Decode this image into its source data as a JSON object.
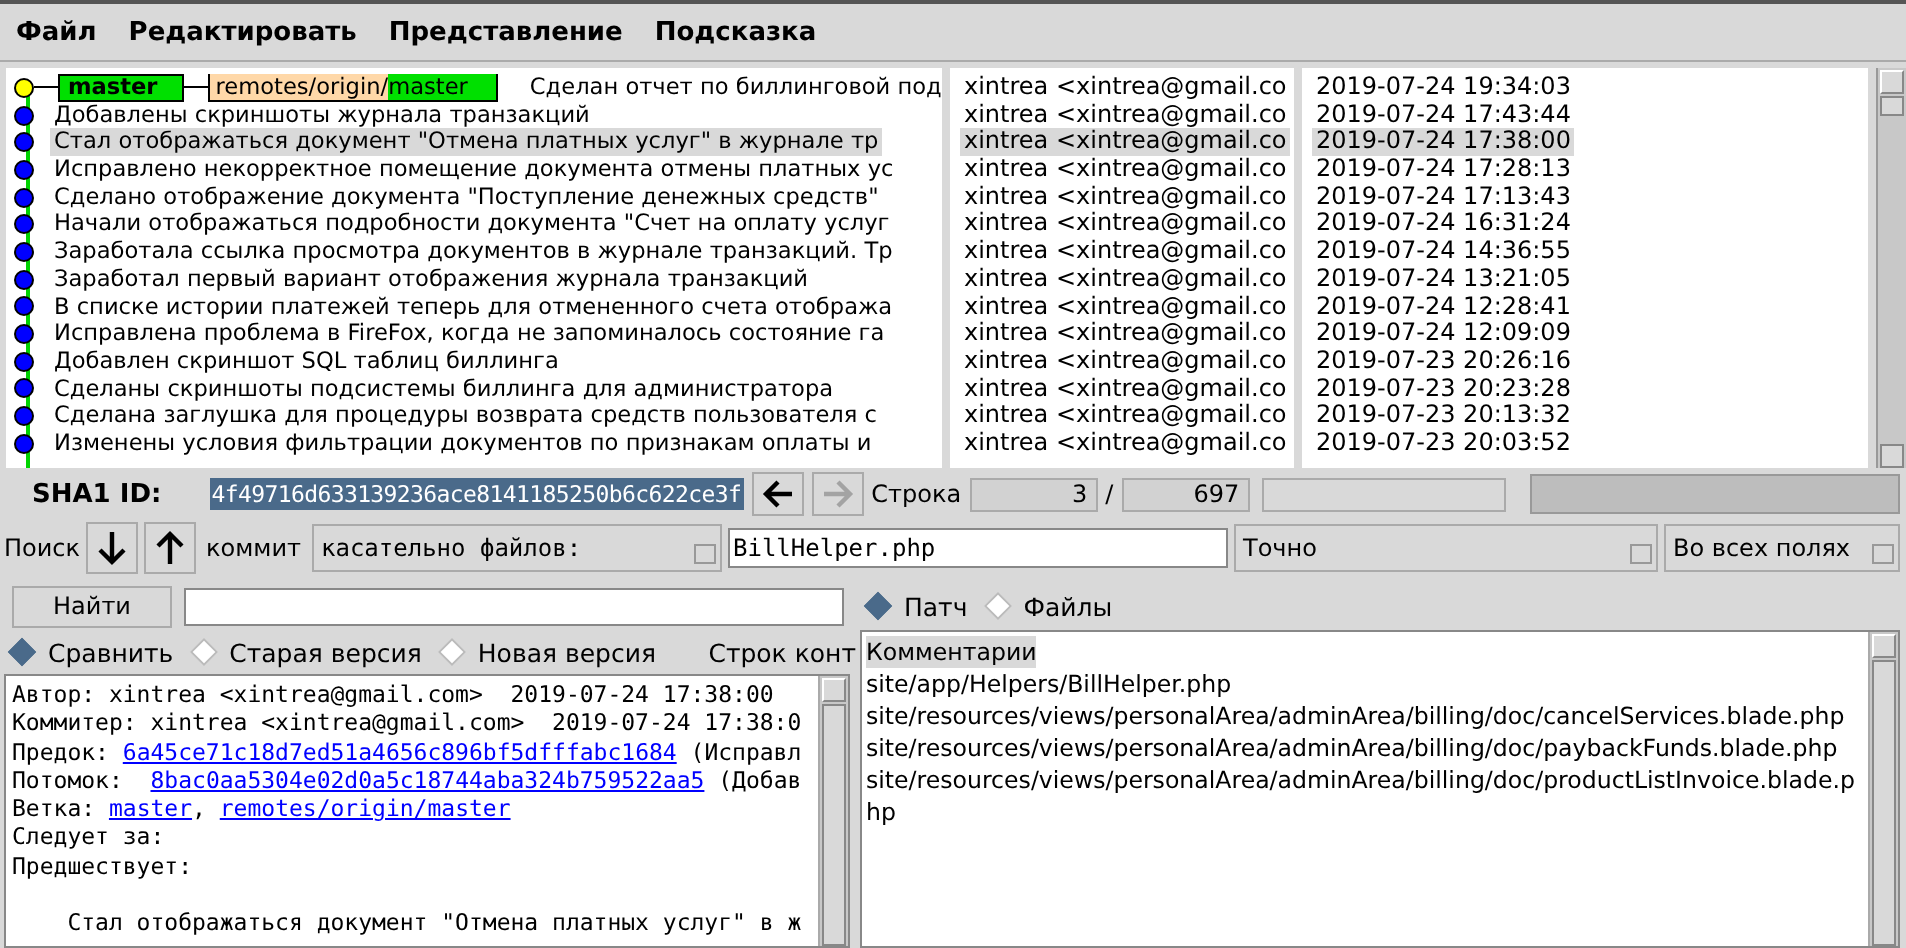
{
  "menu": [
    "Файл",
    "Редактировать",
    "Представление",
    "Подсказка"
  ],
  "refs": [
    {
      "kind": "local",
      "name": "master"
    },
    {
      "kind": "remote",
      "prefix": "remotes/origin/",
      "name": "master"
    }
  ],
  "commits": [
    {
      "message": "Сделан отчет по биллинговой под",
      "author": "xintrea <xintrea@gmail.co",
      "date": "2019-07-24 19:34:03",
      "head": true,
      "selected": false
    },
    {
      "message": "Добавлены скриншоты журнала транзакций",
      "author": "xintrea <xintrea@gmail.co",
      "date": "2019-07-24 17:43:44",
      "head": false,
      "selected": false
    },
    {
      "message": "Стал отображаться документ \"Отмена платных услуг\" в журнале тр",
      "author": "xintrea <xintrea@gmail.co",
      "date": "2019-07-24 17:38:00",
      "head": false,
      "selected": true
    },
    {
      "message": "Исправлено некорректное помещение документа отмены платных ус",
      "author": "xintrea <xintrea@gmail.co",
      "date": "2019-07-24 17:28:13",
      "head": false,
      "selected": false
    },
    {
      "message": "Сделано отображение документа \"Поступление денежных средств\"",
      "author": "xintrea <xintrea@gmail.co",
      "date": "2019-07-24 17:13:43",
      "head": false,
      "selected": false
    },
    {
      "message": "Начали отображаться подробности документа \"Счет на оплату услуг",
      "author": "xintrea <xintrea@gmail.co",
      "date": "2019-07-24 16:31:24",
      "head": false,
      "selected": false
    },
    {
      "message": "Заработала ссылка просмотра документов в журнале транзакций. Тр",
      "author": "xintrea <xintrea@gmail.co",
      "date": "2019-07-24 14:36:55",
      "head": false,
      "selected": false
    },
    {
      "message": "Заработал первый вариант отображения журнала транзакций",
      "author": "xintrea <xintrea@gmail.co",
      "date": "2019-07-24 13:21:05",
      "head": false,
      "selected": false
    },
    {
      "message": "В списке истории платежей теперь для отмененного счета отобража",
      "author": "xintrea <xintrea@gmail.co",
      "date": "2019-07-24 12:28:41",
      "head": false,
      "selected": false
    },
    {
      "message": "Исправлена проблема в FireFox, когда не запоминалось состояние га",
      "author": "xintrea <xintrea@gmail.co",
      "date": "2019-07-24 12:09:09",
      "head": false,
      "selected": false
    },
    {
      "message": "Добавлен скриншот SQL таблиц биллинга",
      "author": "xintrea <xintrea@gmail.co",
      "date": "2019-07-23 20:26:16",
      "head": false,
      "selected": false
    },
    {
      "message": "Сделаны скриншоты подсистемы биллинга для администратора",
      "author": "xintrea <xintrea@gmail.co",
      "date": "2019-07-23 20:23:28",
      "head": false,
      "selected": false
    },
    {
      "message": "Сделана заглушка для процедуры возврата средств пользователя с",
      "author": "xintrea <xintrea@gmail.co",
      "date": "2019-07-23 20:13:32",
      "head": false,
      "selected": false
    },
    {
      "message": "Изменены условия фильтрации документов по признакам оплаты и",
      "author": "xintrea <xintrea@gmail.co",
      "date": "2019-07-23 20:03:52",
      "head": false,
      "selected": false
    }
  ],
  "sha": {
    "label": "SHA1 ID:",
    "value": "4f49716d633139236ace8141185250b6c622ce3f"
  },
  "nav": [
    {
      "kind": "back",
      "disabled": false
    },
    {
      "kind": "forward",
      "disabled": true
    }
  ],
  "row": {
    "label": "Строка",
    "current": "3",
    "separator": "/",
    "total": "697"
  },
  "search": {
    "label": "Поиск",
    "target": "коммит",
    "type": "касательно файлов:",
    "value": "BillHelper.php",
    "mode": "Точно",
    "fields": "Во всех полях"
  },
  "find": {
    "button": "Найти"
  },
  "diff_modes": [
    {
      "label": "Сравнить",
      "selected": true
    },
    {
      "label": "Старая версия",
      "selected": false
    },
    {
      "label": "Новая версия",
      "selected": false
    }
  ],
  "context_label": "Строк конт",
  "details": [
    {
      "blank_before": false,
      "parts": [
        {
          "text": "Автор: xintrea <xintrea@gmail.com>  2019-07-24 17:38:00",
          "link": false
        }
      ]
    },
    {
      "blank_before": false,
      "parts": [
        {
          "text": "Коммитер: xintrea <xintrea@gmail.com>  2019-07-24 17:38:0",
          "link": false
        }
      ]
    },
    {
      "blank_before": false,
      "parts": [
        {
          "text": "Предок: ",
          "link": false
        },
        {
          "text": "6a45ce71c18d7ed51a4656c896bf5dfffabc1684",
          "link": true
        },
        {
          "text": " (Исправл",
          "link": false
        }
      ]
    },
    {
      "blank_before": false,
      "parts": [
        {
          "text": "Потомок:  ",
          "link": false
        },
        {
          "text": "8bac0aa5304e02d0a5c18744aba324b759522aa5",
          "link": true
        },
        {
          "text": " (Добав",
          "link": false
        }
      ]
    },
    {
      "blank_before": false,
      "parts": [
        {
          "text": "Ветка: ",
          "link": false
        },
        {
          "text": "master",
          "link": true
        },
        {
          "text": ", ",
          "link": false
        },
        {
          "text": "remotes/origin/master",
          "link": true
        }
      ]
    },
    {
      "blank_before": false,
      "parts": [
        {
          "text": "Следует за:",
          "link": false
        }
      ]
    },
    {
      "blank_before": false,
      "parts": [
        {
          "text": "Предшествует:",
          "link": false
        }
      ]
    },
    {
      "blank_before": true,
      "parts": [
        {
          "text": "    Стал отображаться документ \"Отмена платных услуг\" в ж",
          "link": false
        }
      ]
    }
  ],
  "view_modes": [
    {
      "label": "Патч",
      "selected": true
    },
    {
      "label": "Файлы",
      "selected": false
    }
  ],
  "files": [
    {
      "path": "Комментарии",
      "selected": true
    },
    {
      "path": "site/app/Helpers/BillHelper.php",
      "selected": false
    },
    {
      "path": "site/resources/views/personalArea/adminArea/billing/doc/cancelServices.blade.php",
      "selected": false
    },
    {
      "path": "site/resources/views/personalArea/adminArea/billing/doc/paybackFunds.blade.php",
      "selected": false
    },
    {
      "path": "site/resources/views/personalArea/adminArea/billing/doc/productListInvoice.blade.php",
      "selected": false
    }
  ]
}
